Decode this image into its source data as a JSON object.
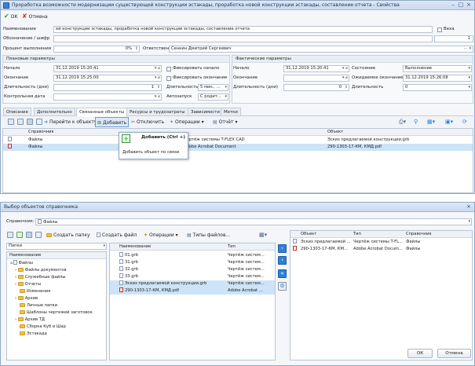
{
  "top_window": {
    "title": "Проработка возможности модернизации существующей конструкции эстакады, проработка новой конструкции эстакады, составление отчета - Свойства",
    "toolbar": {
      "ok": "ОК",
      "cancel": "Отмена"
    },
    "fields": {
      "name_label": "Наименование",
      "name_value": "ей конструкции эстакады, проработка новой конструкции эстакады, составление отчета",
      "milestone_label": "Веха",
      "code_label": "Обозначение / шифр",
      "code_value": "",
      "code_number": "1",
      "percent_label": "Процент выполнения",
      "percent_value": "0%",
      "responsible_label": "Ответственный",
      "responsible_value": "Сенкин Дмитрий Сергеевич"
    },
    "planned": {
      "header": "Плановые параметры",
      "start_label": "Начало",
      "start_value": "31.12.2019 15:20:41",
      "end_label": "Окончание",
      "end_value": "31.12.2019 15:25:00",
      "duration_label": "Длительность (дни)",
      "duration_value": "1",
      "control_label": "Контрольная дата",
      "control_value": "",
      "fix_start": "Фиксировать начало",
      "fix_end": "Фиксировать окончание",
      "duration2_label": "Длительность",
      "duration2_value": "5 мин., ...",
      "autostart_label": "Автозапуск",
      "autostart_value": "С родит..."
    },
    "actual": {
      "header": "Фактические параметры",
      "start_label": "Начало",
      "start_value": "31.12.2019 15:20:41",
      "end_label": "Окончание",
      "end_value": "",
      "duration_label": "Длительность (дни)",
      "duration_value": "0",
      "state_label": "Состояние",
      "state_value": "Выполнение",
      "expected_label": "Ожидаемое окончание",
      "expected_value": "31.12.2019 15:26:08",
      "duration2_label": "Длительность",
      "duration2_value": "0"
    },
    "tabs": [
      "Описание",
      "Дополнительно",
      "Связанные объекты",
      "Ресурсы и трудозатраты",
      "Зависимости",
      "Метки"
    ],
    "objects_toolbar": {
      "goto": "Перейти к объекту",
      "add": "Добавить",
      "detach": "Отключить",
      "operations": "Операции",
      "report": "Отчёт"
    },
    "grid": {
      "columns": [
        "Справочник",
        "Объект"
      ],
      "rows": [
        {
          "catalog": "Файлы",
          "mid": "Чертёж системы T-FLEX CAD",
          "object": "Эскиз предлагаемой конструкции.grb"
        },
        {
          "catalog": "Файлы",
          "mid": "Adobe Acrobat Document",
          "object": "290-1303-17-КМ, КМД.pdf"
        }
      ]
    },
    "tooltip": {
      "title": "Добавить (Ctrl +)",
      "text": "Добавить объект по связи"
    }
  },
  "bottom_window": {
    "title": "Выбор объектов справочника",
    "catalog_label": "Справочник:",
    "catalog_value": "Файлы",
    "toolbar": {
      "create_folder": "Создать папку",
      "create_file": "Создать файл",
      "operations": "Операции",
      "file_types": "Типы файлов..."
    },
    "folders_label": "Папки",
    "tree_header": "Наименование",
    "tree": [
      "Файлы",
      "Файлы документов",
      "Служебные файлы",
      "Отчеты",
      "Изменения",
      "Архив",
      "Личные папки",
      "Шаблоны чертежей заготовок",
      "Архив ТД",
      "Сборка Куб и Шар",
      "Эстакада"
    ],
    "files": {
      "columns": [
        "Наименование",
        "Тип"
      ],
      "rows": [
        {
          "name": "01.grb",
          "type": "Чертёж систем..."
        },
        {
          "name": "31.grb",
          "type": "Чертёж систем..."
        },
        {
          "name": "32.grb",
          "type": "Чертёж систем..."
        },
        {
          "name": "33.grb",
          "type": "Чертёж систем..."
        },
        {
          "name": "Эскиз предлагаемой конструкции.grb",
          "type": "Чертёж систем..."
        },
        {
          "name": "290-1303-17-КМ, КМД.pdf",
          "type": "Adobe Acrobat ..."
        }
      ]
    },
    "selected": {
      "columns": [
        "Объект",
        "Тип",
        "Справочник"
      ],
      "rows": [
        {
          "object": "Эскиз предлагаемой ...",
          "type": "Чертёж системы T-FL...",
          "catalog": "Файлы"
        },
        {
          "object": "290-1303-17-КМ, КМ...",
          "type": "Adobe Acrobat Docum...",
          "catalog": "Файлы"
        }
      ]
    },
    "ok": "ОК",
    "cancel": "Отмена"
  },
  "colors": {
    "accent": "#2f80d6",
    "selection": "#cde3f7",
    "titlebar": "#c9d9ee"
  }
}
